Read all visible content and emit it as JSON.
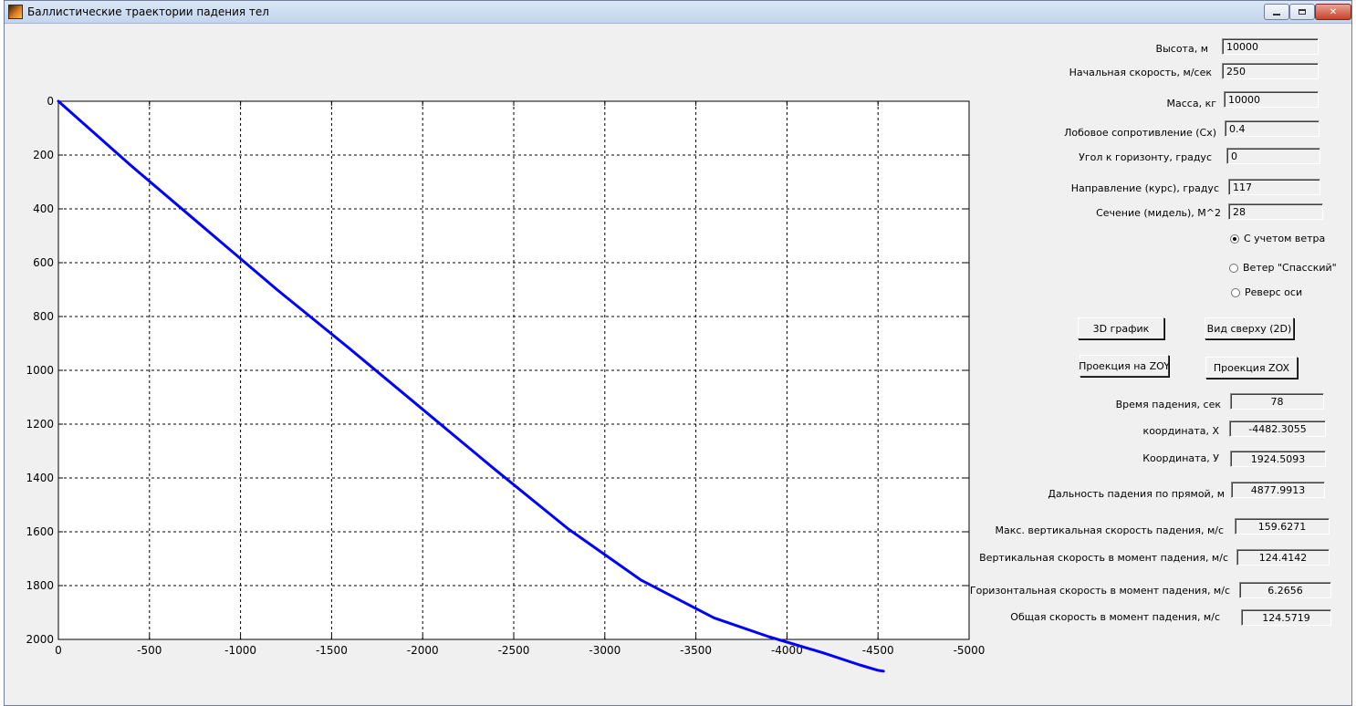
{
  "window": {
    "title": "Баллистические траектории падения тел",
    "controls": {
      "minimize": "minimize-icon",
      "maximize": "maximize-icon",
      "close": "✕"
    }
  },
  "inputs": [
    {
      "label": "Высота, м",
      "value": "10000"
    },
    {
      "label": "Начальная скорость, м/сек",
      "value": "250"
    },
    {
      "label": "Масса, кг",
      "value": "10000"
    },
    {
      "label": "Лобовое сопротивление (Cx)",
      "value": "0.4"
    },
    {
      "label": "Угол к горизонту, градус",
      "value": "0"
    },
    {
      "label": "Направление  (курс), градус",
      "value": "117"
    },
    {
      "label": "Сечение (мидель), М^2",
      "value": "28"
    }
  ],
  "options": [
    {
      "label": "С учетом ветра",
      "selected": true
    },
    {
      "label": "Ветер \"Спасский\"",
      "selected": false
    },
    {
      "label": "Реверс оси",
      "selected": false
    }
  ],
  "buttons": {
    "plot3d": "3D график",
    "top_view": "Вид сверху (2D)",
    "proj_zoy": "Проекция на ZOY",
    "proj_zox": "Проекция ZOX"
  },
  "results": [
    {
      "label": "Время падения, сек",
      "value": "78"
    },
    {
      "label": "координата, X",
      "value": "-4482.3055"
    },
    {
      "label": "Координата, У",
      "value": "1924.5093"
    },
    {
      "label": "Дальность падения по прямой, м",
      "value": "4877.9913"
    },
    {
      "label": "Макс.  вертикальная скорость падения, м/с",
      "value": "159.6271"
    },
    {
      "label": "Вертикальная  скорость в момент падения, м/с",
      "value": "124.4142"
    },
    {
      "label": "Горизонтальная скорость в момент падения, м/с",
      "value": "6.2656"
    },
    {
      "label": "Общая скорость в момент падения, м/с",
      "value": "124.5719"
    }
  ],
  "chart_data": {
    "type": "line",
    "xlim": [
      0,
      -5000
    ],
    "ylim": [
      0,
      2000
    ],
    "y_reversed": true,
    "grid": true,
    "x_ticks": [
      "0",
      "-500",
      "-1000",
      "-1500",
      "-2000",
      "-2500",
      "-3000",
      "-3500",
      "-4000",
      "-4500",
      "-5000"
    ],
    "y_ticks": [
      "0",
      "200",
      "400",
      "600",
      "800",
      "1000",
      "1200",
      "1400",
      "1600",
      "1800",
      "2000"
    ],
    "series": [
      {
        "color": "#0000ff",
        "x": [
          0,
          -400,
          -800,
          -1200,
          -1600,
          -2000,
          -2400,
          -2800,
          -3200,
          -3600,
          -3900,
          -4200,
          -4400,
          -4500,
          -4530
        ],
        "y": [
          0,
          240,
          470,
          700,
          920,
          1145,
          1370,
          1590,
          1780,
          1920,
          1990,
          2050,
          2095,
          2115,
          2118
        ]
      }
    ]
  }
}
